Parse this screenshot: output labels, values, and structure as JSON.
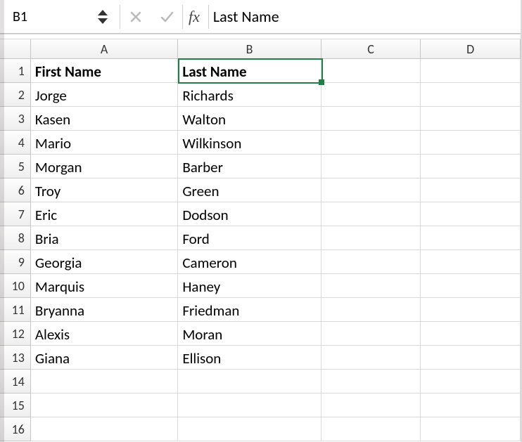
{
  "formula_bar": {
    "cell_ref": "B1",
    "fx_label": "fx",
    "value": "Last Name"
  },
  "grid": {
    "columns": [
      "A",
      "B",
      "C",
      "D"
    ],
    "selected_cell": "B1",
    "rows": [
      {
        "n": 1,
        "a": "First Name",
        "b": "Last Name",
        "is_header": true
      },
      {
        "n": 2,
        "a": "Jorge",
        "b": "Richards"
      },
      {
        "n": 3,
        "a": "Kasen",
        "b": "Walton"
      },
      {
        "n": 4,
        "a": "Mario",
        "b": "Wilkinson"
      },
      {
        "n": 5,
        "a": "Morgan",
        "b": "Barber"
      },
      {
        "n": 6,
        "a": "Troy",
        "b": "Green"
      },
      {
        "n": 7,
        "a": "Eric",
        "b": "Dodson"
      },
      {
        "n": 8,
        "a": "Bria",
        "b": "Ford"
      },
      {
        "n": 9,
        "a": "Georgia",
        "b": "Cameron"
      },
      {
        "n": 10,
        "a": "Marquis",
        "b": "Haney"
      },
      {
        "n": 11,
        "a": "Bryanna",
        "b": "Friedman"
      },
      {
        "n": 12,
        "a": "Alexis",
        "b": "Moran"
      },
      {
        "n": 13,
        "a": "Giana",
        "b": "Ellison"
      },
      {
        "n": 14,
        "a": "",
        "b": ""
      },
      {
        "n": 15,
        "a": "",
        "b": ""
      },
      {
        "n": 16,
        "a": "",
        "b": ""
      }
    ]
  },
  "chart_data": {
    "type": "table",
    "columns": [
      "First Name",
      "Last Name"
    ],
    "rows": [
      [
        "Jorge",
        "Richards"
      ],
      [
        "Kasen",
        "Walton"
      ],
      [
        "Mario",
        "Wilkinson"
      ],
      [
        "Morgan",
        "Barber"
      ],
      [
        "Troy",
        "Green"
      ],
      [
        "Eric",
        "Dodson"
      ],
      [
        "Bria",
        "Ford"
      ],
      [
        "Georgia",
        "Cameron"
      ],
      [
        "Marquis",
        "Haney"
      ],
      [
        "Bryanna",
        "Friedman"
      ],
      [
        "Alexis",
        "Moran"
      ],
      [
        "Giana",
        "Ellison"
      ]
    ]
  }
}
